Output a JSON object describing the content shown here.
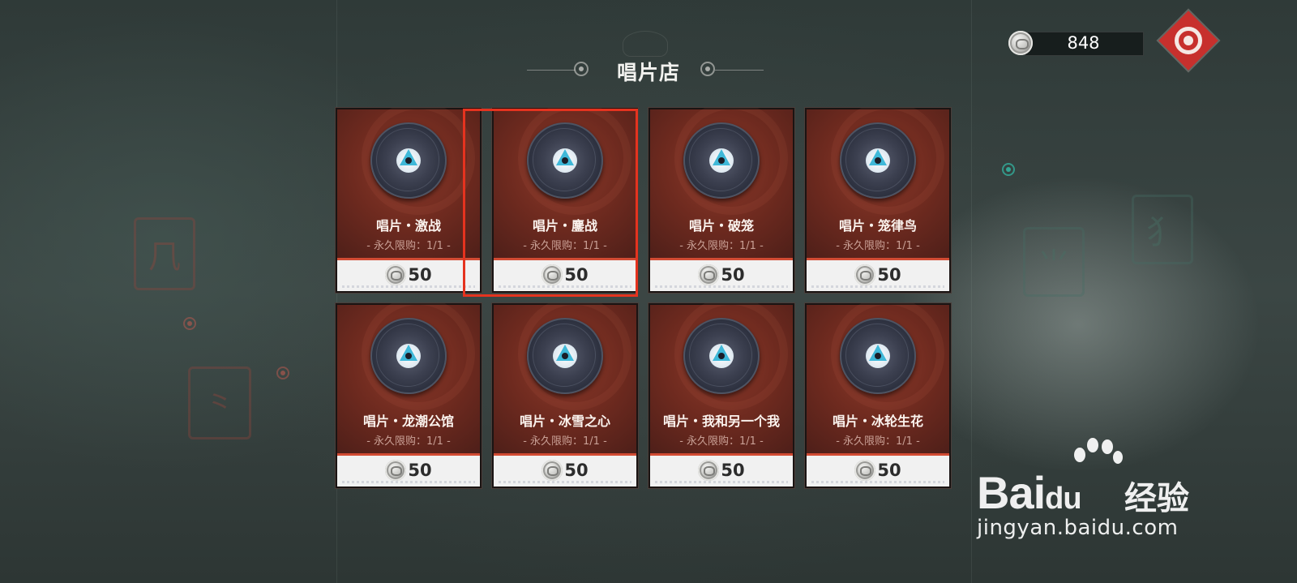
{
  "header": {
    "title": "唱片店"
  },
  "currency": {
    "amount": "848",
    "icon": "silver-coin-icon"
  },
  "menu": {
    "icon": "menu-emblem-icon",
    "color": "#c7302d"
  },
  "highlight_color": "#e5331f",
  "shop": {
    "items": [
      {
        "name": "唱片・激战",
        "limit": "- 永久限购：1/1 -",
        "price": "50"
      },
      {
        "name": "唱片・鏖战",
        "limit": "- 永久限购：1/1 -",
        "price": "50"
      },
      {
        "name": "唱片・破笼",
        "limit": "- 永久限购：1/1 -",
        "price": "50"
      },
      {
        "name": "唱片・笼律鸟",
        "limit": "- 永久限购：1/1 -",
        "price": "50"
      },
      {
        "name": "唱片・龙潮公馆",
        "limit": "- 永久限购：1/1 -",
        "price": "50"
      },
      {
        "name": "唱片・冰雪之心",
        "limit": "- 永久限购：1/1 -",
        "price": "50"
      },
      {
        "name": "唱片・我和另一个我",
        "limit": "- 永久限购：1/1 -",
        "price": "50"
      },
      {
        "name": "唱片・冰轮生花",
        "limit": "- 永久限购：1/1 -",
        "price": "50"
      }
    ]
  },
  "watermark": {
    "logo_a": "Bai",
    "logo_b": "du",
    "cn": "经验",
    "url": "jingyan.baidu.com"
  }
}
